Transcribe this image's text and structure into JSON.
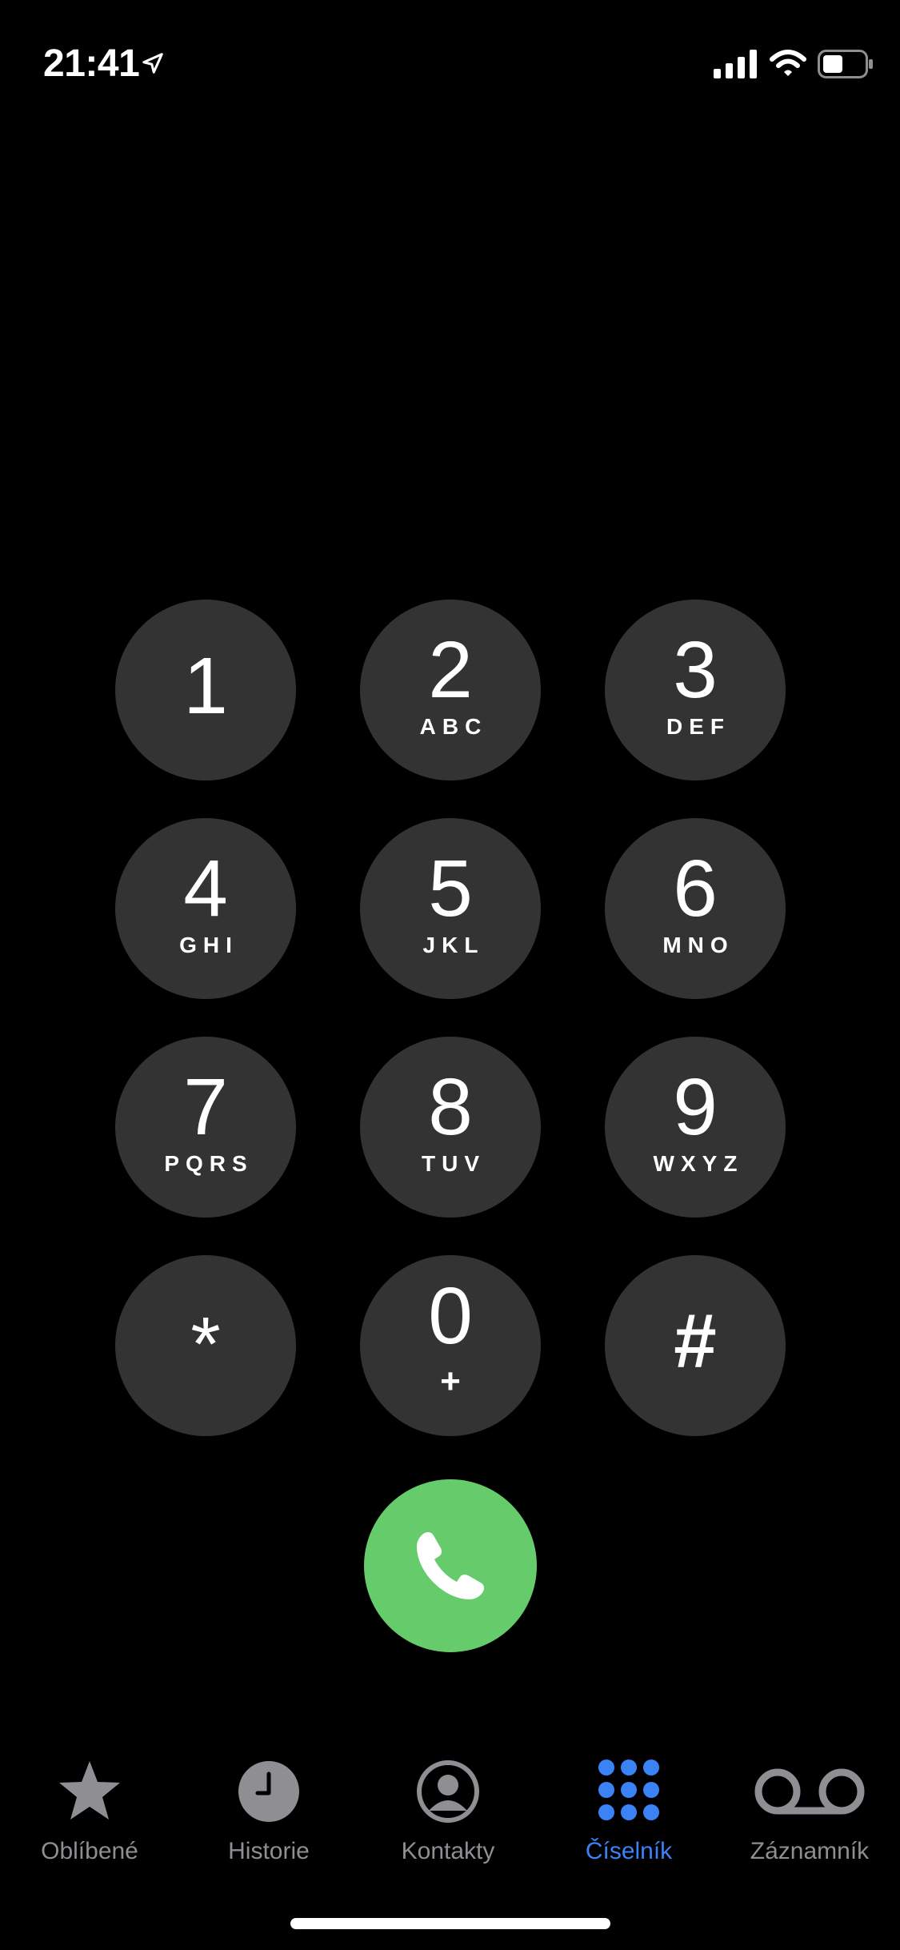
{
  "status_bar": {
    "time": "21:41",
    "icons": [
      "location-arrow-icon",
      "cellular-signal-icon",
      "wifi-icon",
      "battery-icon"
    ]
  },
  "keypad": {
    "keys": [
      {
        "digit": "1",
        "letters": ""
      },
      {
        "digit": "2",
        "letters": "ABC"
      },
      {
        "digit": "3",
        "letters": "DEF"
      },
      {
        "digit": "4",
        "letters": "GHI"
      },
      {
        "digit": "5",
        "letters": "JKL"
      },
      {
        "digit": "6",
        "letters": "MNO"
      },
      {
        "digit": "7",
        "letters": "PQRS"
      },
      {
        "digit": "8",
        "letters": "TUV"
      },
      {
        "digit": "9",
        "letters": "WXYZ"
      },
      {
        "digit": "*",
        "letters": ""
      },
      {
        "digit": "0",
        "letters": "+"
      },
      {
        "digit": "#",
        "letters": ""
      }
    ],
    "call_button_icon": "phone-icon",
    "colors": {
      "key_background": "#333333",
      "call_green": "#65cb6b"
    }
  },
  "tab_bar": {
    "tabs": [
      {
        "label": "Oblíbené",
        "icon": "star-icon"
      },
      {
        "label": "Historie",
        "icon": "clock-icon"
      },
      {
        "label": "Kontakty",
        "icon": "person-circle-icon"
      },
      {
        "label": "Číselník",
        "icon": "keypad-grid-icon"
      },
      {
        "label": "Záznamník",
        "icon": "voicemail-icon"
      }
    ],
    "active": "Číselník",
    "colors": {
      "active": "#3b82f6",
      "inactive": "#8e8e93"
    }
  }
}
